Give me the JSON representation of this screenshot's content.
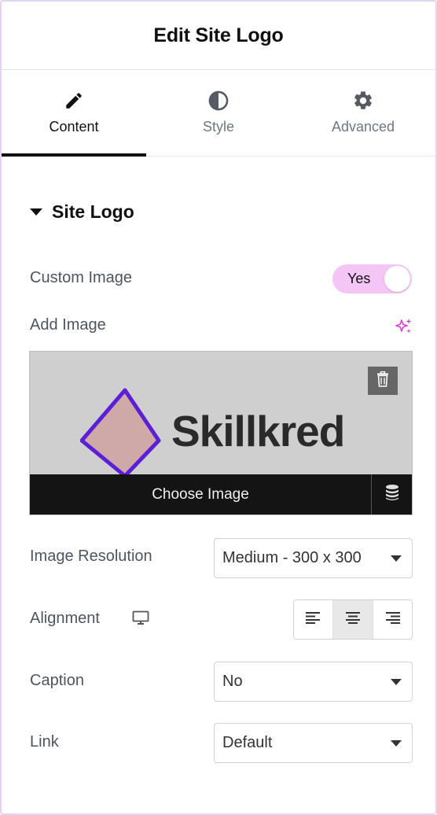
{
  "header": {
    "title": "Edit Site Logo"
  },
  "tabs": [
    {
      "label": "Content",
      "icon": "pencil-icon",
      "active": true
    },
    {
      "label": "Style",
      "icon": "contrast-icon",
      "active": false
    },
    {
      "label": "Advanced",
      "icon": "gear-icon",
      "active": false
    }
  ],
  "section": {
    "title": "Site Logo",
    "expanded": true
  },
  "custom_image": {
    "label": "Custom Image",
    "toggle_label": "Yes",
    "value": true
  },
  "add_image": {
    "label": "Add Image",
    "ai_icon": "sparkle-icon"
  },
  "media": {
    "logo_text": "Skillkred",
    "choose_label": "Choose Image",
    "delete_icon": "trash-icon",
    "library_icon": "database-icon"
  },
  "image_resolution": {
    "label": "Image Resolution",
    "value": "Medium - 300 x 300"
  },
  "alignment": {
    "label": "Alignment",
    "device_icon": "desktop-icon",
    "options": [
      "align-left-icon",
      "align-center-icon",
      "align-right-icon"
    ],
    "selected": "center"
  },
  "caption": {
    "label": "Caption",
    "value": "No"
  },
  "link": {
    "label": "Link",
    "value": "Default"
  },
  "colors": {
    "accent_toggle": "#f4c6f5",
    "sparkle": "#d63fd6",
    "logo_stroke": "#5a1fd6",
    "logo_fill": "#cfa8a8",
    "frame_border": "#e3d3f5"
  }
}
